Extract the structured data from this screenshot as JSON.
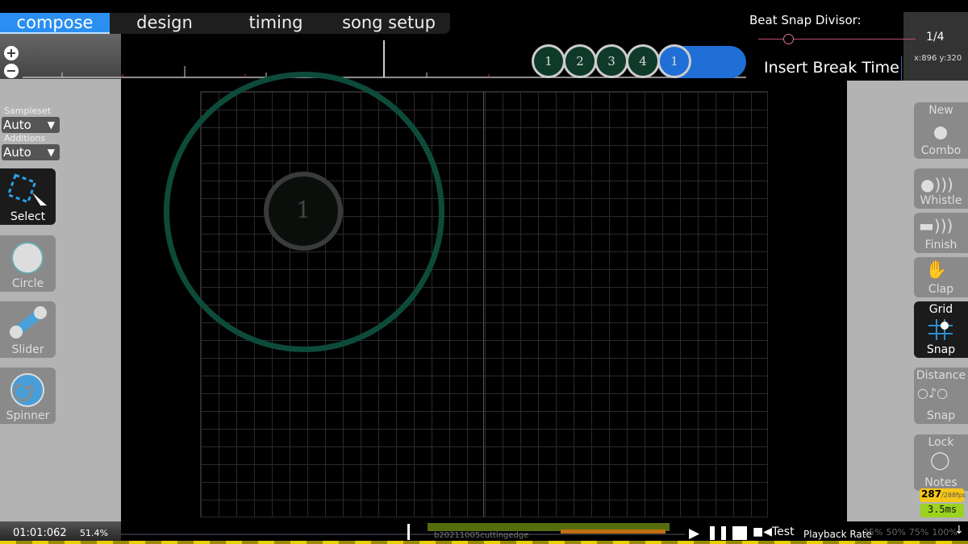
{
  "tabs": [
    {
      "label": "compose",
      "active": true
    },
    {
      "label": "design"
    },
    {
      "label": "timing"
    },
    {
      "label": "song setup"
    }
  ],
  "zoom": {
    "in": "+",
    "out": "−"
  },
  "beat_snap": {
    "label": "Beat Snap Divisor:",
    "value": "1/4",
    "slider_fraction": 0.2
  },
  "coords": "x:896 y:320",
  "insert_break": "Insert Break Time",
  "timeline_circles": [
    "1",
    "2",
    "3",
    "4",
    "1"
  ],
  "left": {
    "sampleset_label": "Sampleset",
    "sampleset_value": "Auto",
    "additions_label": "Additions",
    "additions_value": "Auto",
    "tools": [
      {
        "label": "Select",
        "icon": "select-icon",
        "active": true
      },
      {
        "label": "Circle",
        "icon": "circle-icon"
      },
      {
        "label": "Slider",
        "icon": "slider-icon"
      },
      {
        "label": "Spinner",
        "icon": "spinner-icon"
      }
    ]
  },
  "right": {
    "new_combo": [
      "New",
      "Combo"
    ],
    "whistle": "Whistle",
    "finish": "Finish",
    "clap": "Clap",
    "grid_snap": [
      "Grid",
      "Snap"
    ],
    "distance_snap": [
      "Distance",
      "Snap"
    ],
    "lock_notes": [
      "Lock",
      "Notes"
    ]
  },
  "playfield": {
    "combo_number": "1"
  },
  "stats": {
    "fps": "287",
    "fps_max": "/288fps",
    "frametime": "3.5ms"
  },
  "bottom": {
    "time": "01:01:062",
    "percent": "51.4%",
    "version": "b20211005cuttingedge",
    "test": "Test",
    "playback_label": "Playback Rate",
    "rates": [
      "25%",
      "50%",
      "75%",
      "100%"
    ]
  },
  "colors": {
    "accent": "#2a8ff0",
    "approach": "#0e4a3a",
    "fps_bg": "#f5c518",
    "ms_bg": "#9ad21e"
  }
}
